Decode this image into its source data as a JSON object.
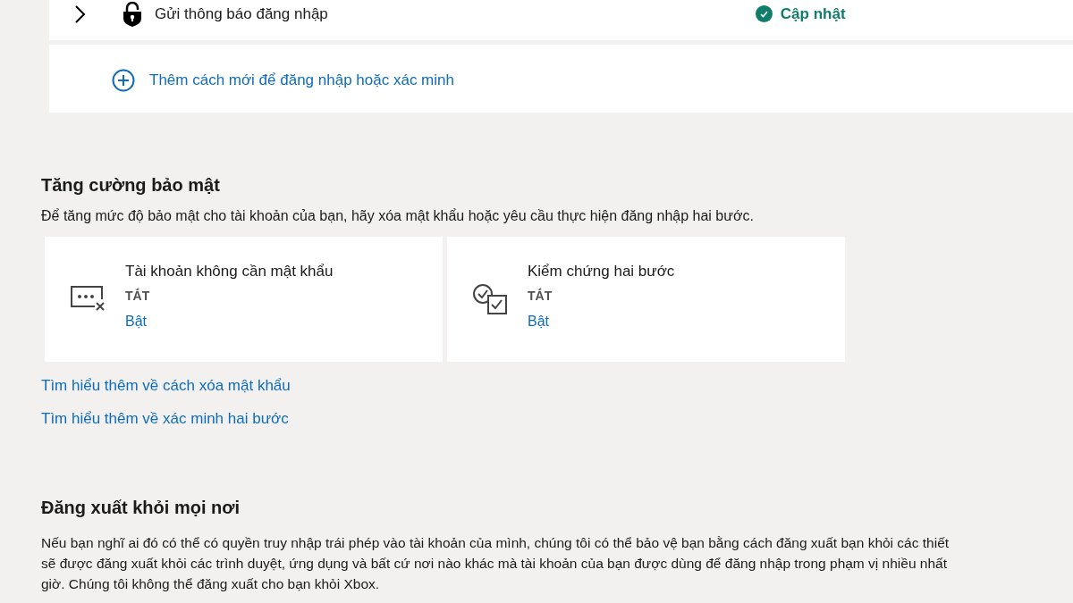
{
  "sign_in_methods": {
    "rows": [
      {
        "label": "Gửi thông báo đăng nhập",
        "expanded": false,
        "status": "Cập nhật"
      }
    ],
    "add_link": "Thêm cách mới để đăng nhập hoặc xác minh"
  },
  "security": {
    "title": "Tăng cường bảo mật",
    "description": "Để tăng mức độ bảo mật cho tài khoản của bạn, hãy xóa mật khẩu hoặc yêu cầu thực hiện đăng nhập hai bước.",
    "cards": [
      {
        "kind": "passwordless",
        "title": "Tài khoản không cần mật khẩu",
        "state": "TẮT",
        "action": "Bật"
      },
      {
        "kind": "two_step",
        "title": "Kiểm chứng hai bước",
        "state": "TẮT",
        "action": "Bật"
      }
    ],
    "links": [
      "Tìm hiểu thêm về cách xóa mật khẩu",
      "Tìm hiểu thêm về xác minh hai bước"
    ]
  },
  "sign_out": {
    "title": "Đăng xuất khỏi mọi nơi",
    "lines": [
      "Nếu bạn nghĩ ai đó có thể có quyền truy nhập trái phép vào tài khoản của mình, chúng tôi có thể bảo vệ bạn bằng cách đăng xuất bạn khỏi các thiết",
      "sẽ được đăng xuất khỏi các trình duyệt, ứng dụng và bất cứ nơi nào khác mà tài khoản của bạn được dùng để đăng nhập trong phạm vị nhiều nhất",
      "giờ. Chúng tôi không thể đăng xuất cho bạn khỏi Xbox."
    ]
  }
}
